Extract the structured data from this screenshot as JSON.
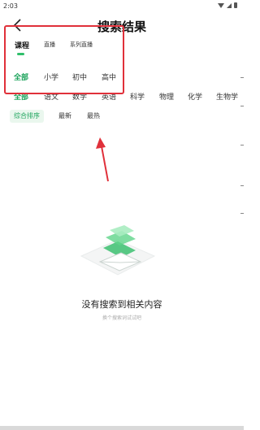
{
  "status_bar": {
    "time": "2:03"
  },
  "header": {
    "title": "搜索结果"
  },
  "tabs": [
    {
      "label": "课程",
      "active": true
    },
    {
      "label": "直播",
      "active": false
    },
    {
      "label": "系列直播",
      "active": false
    }
  ],
  "grades": [
    {
      "label": "全部",
      "active": true
    },
    {
      "label": "小学",
      "active": false
    },
    {
      "label": "初中",
      "active": false
    },
    {
      "label": "高中",
      "active": false
    }
  ],
  "subjects": [
    {
      "label": "全部",
      "active": true
    },
    {
      "label": "语文",
      "active": false
    },
    {
      "label": "数学",
      "active": false
    },
    {
      "label": "英语",
      "active": false
    },
    {
      "label": "科学",
      "active": false
    },
    {
      "label": "物理",
      "active": false
    },
    {
      "label": "化学",
      "active": false
    },
    {
      "label": "生物学",
      "active": false
    }
  ],
  "sort": [
    {
      "label": "综合排序",
      "active": true
    },
    {
      "label": "最新",
      "active": false
    },
    {
      "label": "最热",
      "active": false
    }
  ],
  "empty_state": {
    "title": "没有搜索到相关内容",
    "hint": "换个搜索词试试吧"
  },
  "colors": {
    "accent": "#1aa35a",
    "annotation": "#e0303a"
  }
}
